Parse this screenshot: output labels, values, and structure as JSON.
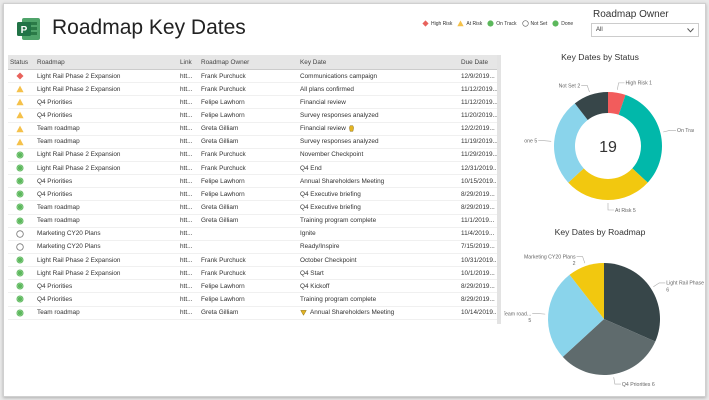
{
  "header": {
    "title": "Roadmap Key Dates"
  },
  "legend": [
    {
      "label": "High Risk",
      "icon": "diamond",
      "color": "#e8625c"
    },
    {
      "label": "At Risk",
      "icon": "triangle",
      "color": "#f5c14a"
    },
    {
      "label": "On Track",
      "icon": "circle",
      "color": "#5cb85c"
    },
    {
      "label": "Not Set",
      "icon": "circle-outline",
      "color": "#666666"
    },
    {
      "label": "Done",
      "icon": "circle",
      "color": "#5cb85c"
    }
  ],
  "slicer": {
    "label": "Roadmap Owner",
    "value": "All"
  },
  "table": {
    "columns": [
      "Status",
      "Roadmap",
      "Link",
      "Roadmap Owner",
      "Key Date",
      "Due Date"
    ],
    "rows": [
      {
        "status": "high-risk",
        "roadmap": "Light Rail Phase 2 Expansion",
        "link": "htt...",
        "owner": "Frank Purchuck",
        "key_date": "Communications campaign",
        "due": "12/9/2019..."
      },
      {
        "status": "at-risk",
        "roadmap": "Light Rail Phase 2 Expansion",
        "link": "htt...",
        "owner": "Frank Purchuck",
        "key_date": "All plans confirmed",
        "due": "11/12/2019..."
      },
      {
        "status": "at-risk",
        "roadmap": "Q4 Priorities",
        "link": "htt...",
        "owner": "Felipe Lawhorn",
        "key_date": "Financial review",
        "due": "11/12/2019..."
      },
      {
        "status": "at-risk",
        "roadmap": "Q4 Priorities",
        "link": "htt...",
        "owner": "Felipe Lawhorn",
        "key_date": "Survey responses analyzed",
        "due": "11/20/2019..."
      },
      {
        "status": "at-risk",
        "roadmap": "Team roadmap",
        "link": "htt...",
        "owner": "Greta Gilliam",
        "key_date": "Financial review",
        "flag": "after",
        "due": "12/2/2019..."
      },
      {
        "status": "at-risk",
        "roadmap": "Team roadmap",
        "link": "htt...",
        "owner": "Greta Gilliam",
        "key_date": "Survey responses analyzed",
        "due": "11/19/2019..."
      },
      {
        "status": "done",
        "roadmap": "Light Rail Phase 2 Expansion",
        "link": "htt...",
        "owner": "Frank Purchuck",
        "key_date": "November Checkpoint",
        "due": "11/29/2019..."
      },
      {
        "status": "done",
        "roadmap": "Light Rail Phase 2 Expansion",
        "link": "htt...",
        "owner": "Frank Purchuck",
        "key_date": "Q4 End",
        "due": "12/31/2019..."
      },
      {
        "status": "done",
        "roadmap": "Q4 Priorities",
        "link": "htt...",
        "owner": "Felipe Lawhorn",
        "key_date": "Annual Shareholders Meeting",
        "due": "10/15/2019..."
      },
      {
        "status": "done",
        "roadmap": "Q4 Priorities",
        "link": "htt...",
        "owner": "Felipe Lawhorn",
        "key_date": "Q4 Executive briefing",
        "due": "8/29/2019..."
      },
      {
        "status": "done",
        "roadmap": "Team roadmap",
        "link": "htt...",
        "owner": "Greta Gilliam",
        "key_date": "Q4 Executive briefing",
        "due": "8/29/2019..."
      },
      {
        "status": "done",
        "roadmap": "Team roadmap",
        "link": "htt...",
        "owner": "Greta Gilliam",
        "key_date": "Training program complete",
        "due": "11/1/2019..."
      },
      {
        "status": "not-set",
        "roadmap": "Marketing CY20 Plans",
        "link": "htt...",
        "owner": "",
        "key_date": "Ignite",
        "due": "11/4/2019..."
      },
      {
        "status": "not-set",
        "roadmap": "Marketing CY20 Plans",
        "link": "htt...",
        "owner": "",
        "key_date": "Ready/Inspire",
        "due": "7/15/2019..."
      },
      {
        "status": "on-track",
        "roadmap": "Light Rail Phase 2 Expansion",
        "link": "htt...",
        "owner": "Frank Purchuck",
        "key_date": "October Checkpoint",
        "due": "10/31/2019..."
      },
      {
        "status": "on-track",
        "roadmap": "Light Rail Phase 2 Expansion",
        "link": "htt...",
        "owner": "Frank Purchuck",
        "key_date": "Q4 Start",
        "due": "10/1/2019..."
      },
      {
        "status": "on-track",
        "roadmap": "Q4 Priorities",
        "link": "htt...",
        "owner": "Felipe Lawhorn",
        "key_date": "Q4 Kickoff",
        "due": "8/29/2019..."
      },
      {
        "status": "on-track",
        "roadmap": "Q4 Priorities",
        "link": "htt...",
        "owner": "Felipe Lawhorn",
        "key_date": "Training program complete",
        "due": "8/29/2019..."
      },
      {
        "status": "on-track",
        "roadmap": "Team roadmap",
        "link": "htt...",
        "owner": "Greta Gilliam",
        "key_date": "Annual Shareholders Meeting",
        "flag": "before",
        "due": "10/14/2019..."
      }
    ]
  },
  "status_colors": {
    "high-risk": "#e8625c",
    "at-risk": "#f5c14a",
    "on-track": "#5cb85c",
    "done": "#5cb85c",
    "not-set": "#666666"
  },
  "chart_data": [
    {
      "type": "pie",
      "variant": "donut",
      "title": "Key Dates by Status",
      "center_label": "19",
      "slices": [
        {
          "label": "High Risk 1",
          "value": 1,
          "color": "#f25c5c"
        },
        {
          "label": "On Track 6",
          "value": 6,
          "color": "#01b8aa"
        },
        {
          "label": "At Risk 5",
          "value": 5,
          "color": "#f2c80f"
        },
        {
          "label": "Done 5",
          "value": 5,
          "color": "#8ad4eb"
        },
        {
          "label": "Not Set 2",
          "value": 2,
          "color": "#374649"
        }
      ]
    },
    {
      "type": "pie",
      "title": "Key Dates by Roadmap",
      "slices": [
        {
          "label": "Light Rail Phase 2 Expan...",
          "label2": "6",
          "value": 6,
          "color": "#374649"
        },
        {
          "label": "Q4 Priorities 6",
          "value": 6,
          "color": "#5f6b6d"
        },
        {
          "label": "Team road...",
          "label2": "5",
          "value": 5,
          "color": "#8ad4eb"
        },
        {
          "label": "Marketing CY20 Plans",
          "label2": "2",
          "value": 2,
          "color": "#f2c80f"
        }
      ]
    }
  ]
}
